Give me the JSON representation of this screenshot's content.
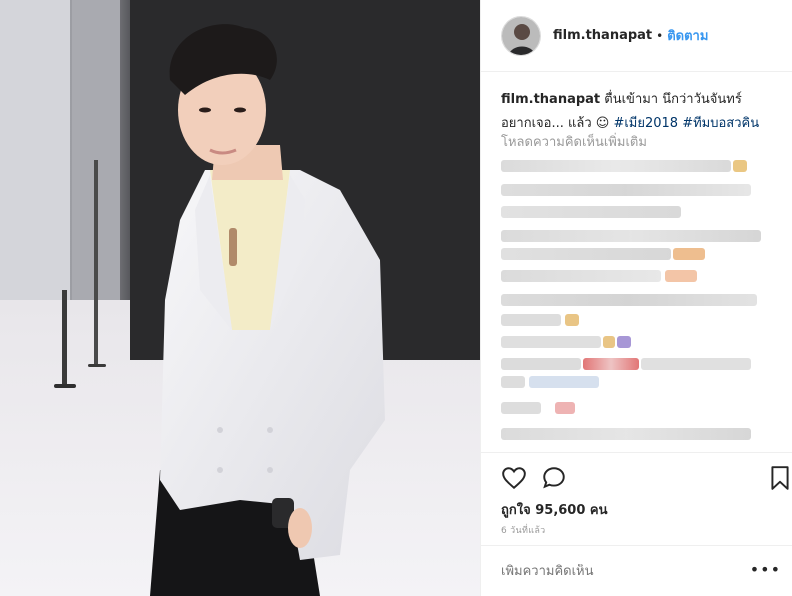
{
  "header": {
    "username": "film.thanapat",
    "separator": "•",
    "follow_label": "ติดตาม"
  },
  "caption": {
    "username": "film.thanapat",
    "text": "ตื่นเข้ามา นึกว่าวันจันทร์ อยากเจอ... แล้ว ☺",
    "hashtags": [
      "#เมีย2018",
      "#ทีมบอสวคิน"
    ]
  },
  "comments": {
    "load_more_label": "โหลดความคิดเห็นเพิ่มเติม",
    "blurred": true
  },
  "actions": {
    "like_icon": "heart-icon",
    "comment_icon": "comment-icon",
    "save_icon": "bookmark-icon"
  },
  "likes": {
    "label": "ถูกใจ 95,600 คน"
  },
  "timestamp": "6 วันที่แล้ว",
  "add_comment": {
    "placeholder": "เพิ่มความคิดเห็น",
    "more_label": "•••"
  },
  "colors": {
    "link_blue": "#3897f0",
    "hashtag": "#003569",
    "muted": "#999999",
    "border": "#efefef"
  }
}
